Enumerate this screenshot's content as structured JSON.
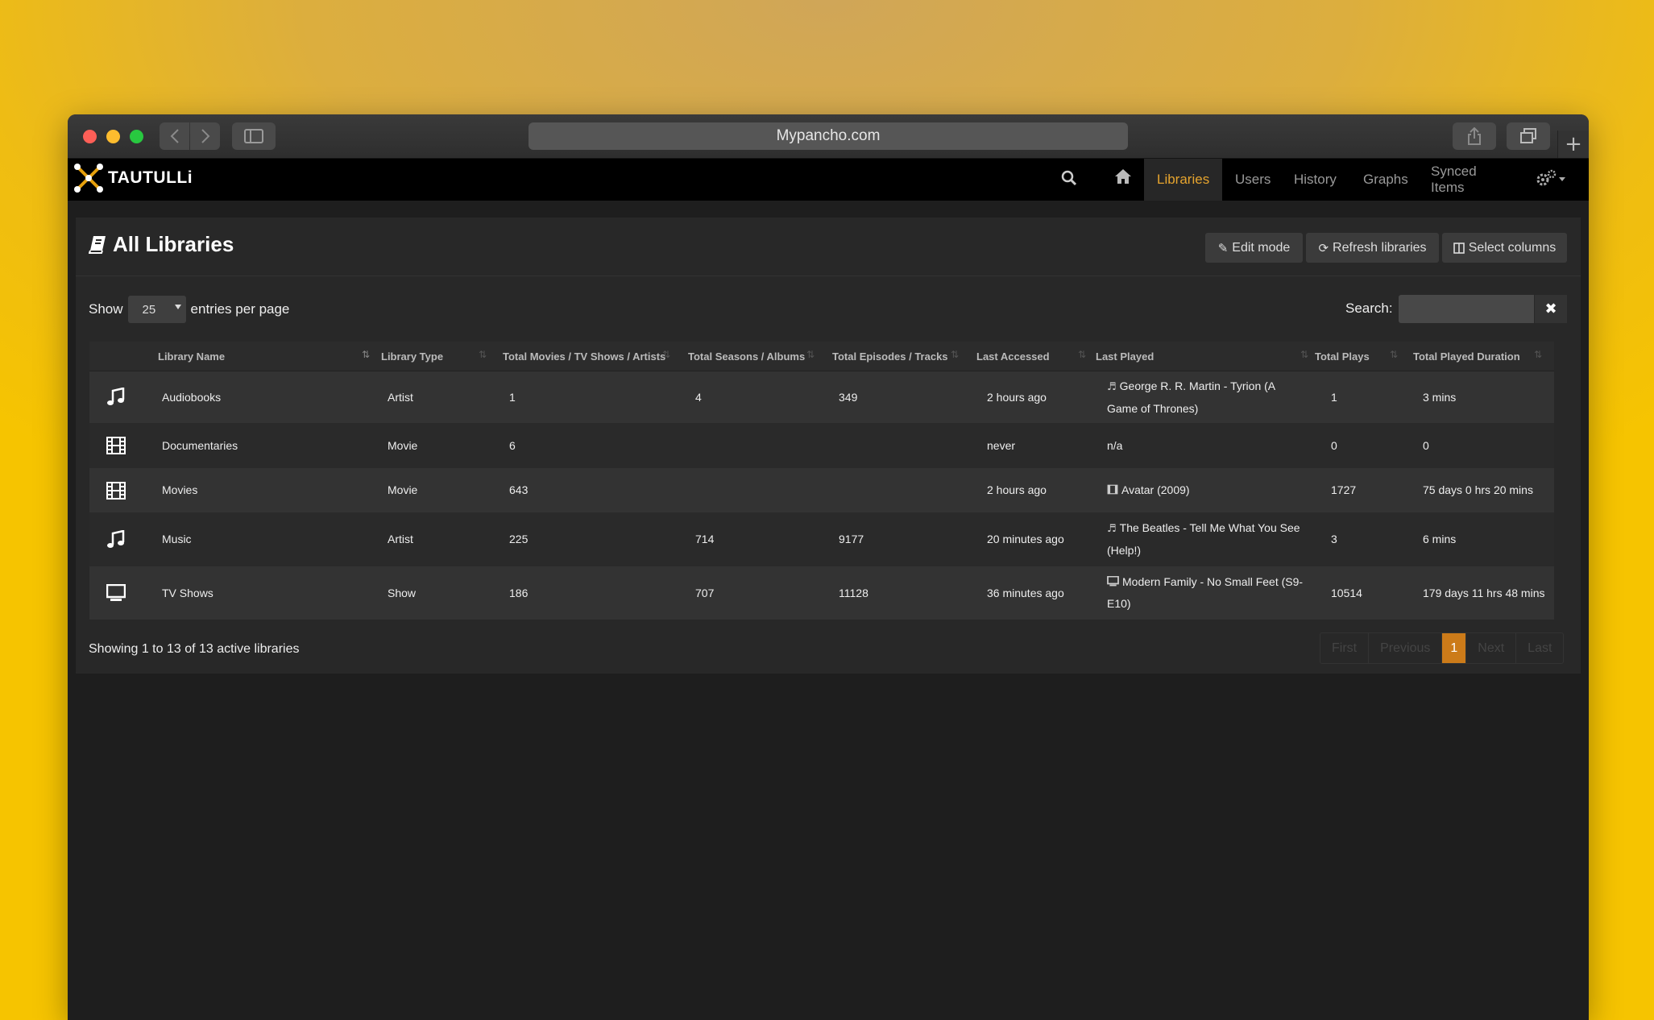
{
  "browser": {
    "url": "Mypancho.com",
    "new_tab": "+"
  },
  "app": {
    "brand": "TAUTULLi",
    "nav": [
      {
        "label": "Libraries",
        "active": true
      },
      {
        "label": "Users",
        "active": false
      },
      {
        "label": "History",
        "active": false
      },
      {
        "label": "Graphs",
        "active": false
      },
      {
        "label": "Synced Items",
        "active": false
      }
    ],
    "accent_color": "#e6a42e"
  },
  "page": {
    "title": "All Libraries",
    "buttons": {
      "edit_mode": "Edit mode",
      "refresh": "Refresh libraries",
      "select_columns": "Select columns"
    },
    "length": {
      "prefix": "Show",
      "value": "25",
      "suffix": "entries per page"
    },
    "search": {
      "label": "Search:",
      "placeholder": ""
    }
  },
  "table": {
    "columns": [
      "Library Name",
      "Library Type",
      "Total Movies / TV Shows / Artists",
      "Total Seasons / Albums",
      "Total Episodes / Tracks",
      "Last Accessed",
      "Last Played",
      "Total Plays",
      "Total Played Duration"
    ],
    "rows": [
      {
        "icon": "music-icon",
        "name": "Audiobooks",
        "type": "Artist",
        "count": "1",
        "seasons": "4",
        "episodes": "349",
        "last_accessed": "2 hours ago",
        "last_played_icon": "music-icon",
        "last_played": "George R. R. Martin - Tyrion (A Game of Thrones)",
        "plays": "1",
        "duration": "3 mins"
      },
      {
        "icon": "film-icon",
        "name": "Documentaries",
        "type": "Movie",
        "count": "6",
        "seasons": "",
        "episodes": "",
        "last_accessed": "never",
        "last_played_icon": "",
        "last_played": "n/a",
        "plays": "0",
        "duration": "0"
      },
      {
        "icon": "film-icon",
        "name": "Movies",
        "type": "Movie",
        "count": "643",
        "seasons": "",
        "episodes": "",
        "last_accessed": "2 hours ago",
        "last_played_icon": "film-icon",
        "last_played": "Avatar (2009)",
        "plays": "1727",
        "duration": "75 days 0 hrs 20 mins"
      },
      {
        "icon": "music-icon",
        "name": "Music",
        "type": "Artist",
        "count": "225",
        "seasons": "714",
        "episodes": "9177",
        "last_accessed": "20 minutes ago",
        "last_played_icon": "music-icon",
        "last_played": "The Beatles - Tell Me What You See (Help!)",
        "plays": "3",
        "duration": "6 mins"
      },
      {
        "icon": "tv-icon",
        "name": "TV Shows",
        "type": "Show",
        "count": "186",
        "seasons": "707",
        "episodes": "11128",
        "last_accessed": "36 minutes ago",
        "last_played_icon": "tv-icon",
        "last_played": "Modern Family - No Small Feet (S9-E10)",
        "plays": "10514",
        "duration": "179 days 11 hrs 48 mins"
      }
    ],
    "info": "Showing 1 to 13 of 13 active libraries"
  },
  "pagination": {
    "first": "First",
    "previous": "Previous",
    "current": "1",
    "next": "Next",
    "last": "Last",
    "active_color": "#cc7b19"
  }
}
